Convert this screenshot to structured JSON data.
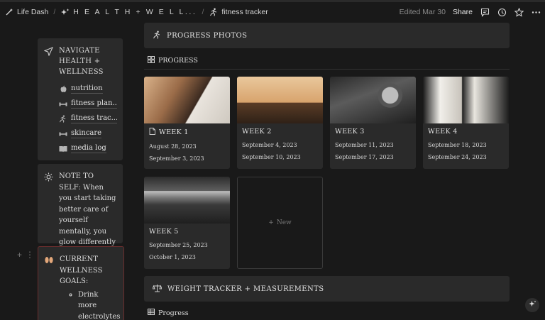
{
  "topbar": {
    "workspace": "Life Dash",
    "crumb2": "H E A L T H + W E L L...",
    "crumb3": "fitness tracker",
    "edited": "Edited Mar 30",
    "share": "Share"
  },
  "sidebar": {
    "nav_title": "NAVIGATE HEALTH + WELLNESS",
    "items": [
      {
        "label": "nutrition",
        "icon": "apple-icon"
      },
      {
        "label": "fitness plan...",
        "icon": "dumbbell-icon"
      },
      {
        "label": "fitness trac...",
        "icon": "runner-icon"
      },
      {
        "label": "skincare",
        "icon": "dumbbell-icon"
      },
      {
        "label": "media log",
        "icon": "book-icon"
      }
    ],
    "note": "NOTE TO SELF: When you start taking better care of yourself mentally, you glow differently",
    "goals_title": "CURRENT WELLNESS GOALS:",
    "goals": [
      "Drink more electrolytes"
    ]
  },
  "photos": {
    "heading": "PROGRESS PHOTOS",
    "view_label": "PROGRESS",
    "new_label": "New",
    "cards": [
      {
        "title": "WEEK 1",
        "start": "August 28, 2023",
        "end": "September 3, 2023"
      },
      {
        "title": "WEEK 2",
        "start": "September 4, 2023",
        "end": "September 10, 2023"
      },
      {
        "title": "WEEK 3",
        "start": "September 11, 2023",
        "end": "September 17, 2023"
      },
      {
        "title": "WEEK 4",
        "start": "September 18, 2023",
        "end": "September 24, 2023"
      },
      {
        "title": "WEEK 5",
        "start": "September 25, 2023",
        "end": "October 1, 2023"
      }
    ]
  },
  "weight": {
    "heading": "WEIGHT TRACKER + MEASUREMENTS",
    "view_label": "Progress"
  }
}
